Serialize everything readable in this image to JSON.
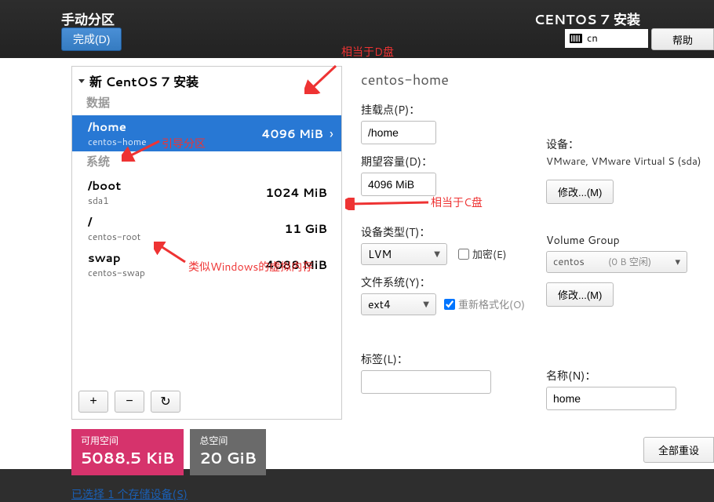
{
  "header": {
    "title_left": "手动分区",
    "done_btn": "完成(D)",
    "title_right": "CENTOS 7 安装",
    "lang": "cn",
    "help_btn": "帮助"
  },
  "annotations": {
    "drive_d": "相当于D盘",
    "boot_part": "引导分区",
    "drive_c": "相当于C盘",
    "swap_note": "类似Windows的虚拟内存"
  },
  "tree": {
    "header": "新 CentOS 7 安装",
    "group_data": "数据",
    "group_sys": "系统",
    "items": [
      {
        "mount": "/home",
        "dev": "centos-home",
        "size": "4096 MiB",
        "selected": true,
        "group": "data"
      },
      {
        "mount": "/boot",
        "dev": "sda1",
        "size": "1024 MiB",
        "selected": false,
        "group": "sys"
      },
      {
        "mount": "/",
        "dev": "centos-root",
        "size": "11 GiB",
        "selected": false,
        "group": "sys"
      },
      {
        "mount": "swap",
        "dev": "centos-swap",
        "size": "4088 MiB",
        "selected": false,
        "group": "sys"
      }
    ]
  },
  "space": {
    "free_lbl": "可用空间",
    "free_val": "5088.5 KiB",
    "total_lbl": "总空间",
    "total_val": "20 GiB"
  },
  "storage_link": "已选择 1 个存储设备(S)",
  "details": {
    "title": "centos-home",
    "mount_lbl": "挂载点(P)：",
    "mount_val": "/home",
    "cap_lbl": "期望容量(D)：",
    "cap_val": "4096 MiB",
    "device_lbl": "设备：",
    "device_val": "VMware, VMware Virtual S (sda)",
    "modify_btn": "修改...(M)",
    "type_lbl": "设备类型(T)：",
    "type_val": "LVM",
    "encrypt_lbl": "加密(E)",
    "fs_lbl": "文件系统(Y)：",
    "fs_val": "ext4",
    "reformat_lbl": "重新格式化(O)",
    "vg_lbl": "Volume Group",
    "vg_val": "centos",
    "vg_free": "(0 B 空闲)",
    "label_lbl": "标签(L)：",
    "name_lbl": "名称(N)：",
    "name_val": "home"
  },
  "reset_btn": "全部重设"
}
